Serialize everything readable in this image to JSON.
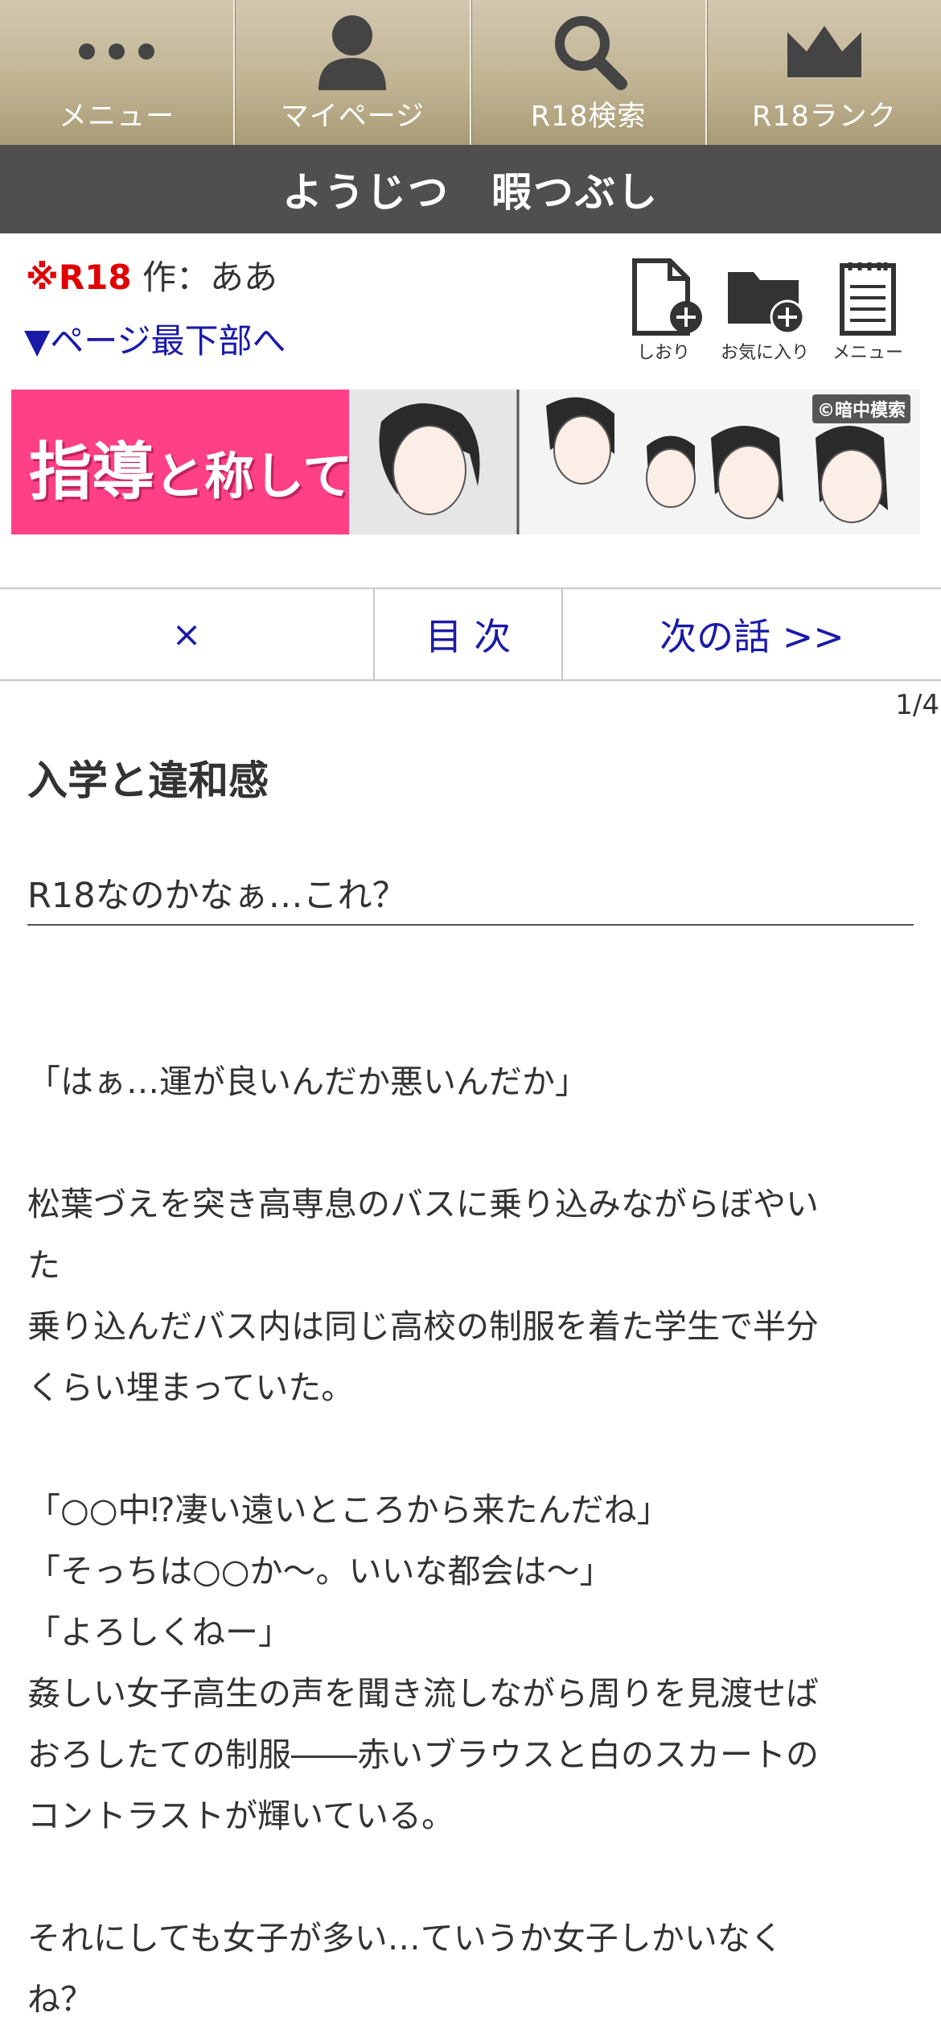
{
  "nav": {
    "items": [
      {
        "label": "メニュー",
        "icon": "dots-icon"
      },
      {
        "label": "マイページ",
        "icon": "person-icon"
      },
      {
        "label": "R18検索",
        "icon": "search-icon"
      },
      {
        "label": "R18ランク",
        "icon": "crown-icon"
      }
    ]
  },
  "title": "ようじつ　暇つぶし",
  "info": {
    "r18_badge": "※R18",
    "author": " 作：ああ",
    "bottom_link": "▼ページ最下部へ"
  },
  "tools": {
    "bookmark_label": "しおり",
    "favorite_label": "お気に入り",
    "menu_label": "メニュー"
  },
  "banner": {
    "headline_big": "指導",
    "headline_small": "と称して…",
    "credit": "©暗中模索"
  },
  "chapter_nav": {
    "close_label": "×",
    "toc_label": "目 次",
    "next_label": "次の話 >>"
  },
  "page_indicator": "1/4",
  "chapter_title": "入学と違和感",
  "subtitle": "R18なのかなぁ…これ？",
  "body_lines": [
    "「はぁ…運が良いんだか悪いんだか」",
    "",
    "松葉づえを突き高専息のバスに乗り込みながらぼやい",
    "た",
    "乗り込んだバス内は同じ高校の制服を着た学生で半分",
    "くらい埋まっていた。",
    "",
    "「○○中⁉凄い遠いところから来たんだね」",
    "「そっちは○○か〜。いいな都会は〜」",
    "「よろしくねー」",
    "姦しい女子高生の声を聞き流しながら周りを見渡せば",
    "おろしたての制服――赤いブラウスと白のスカートの",
    "コントラストが輝いている。",
    "",
    "それにしても女子が多い…ていうか女子しかいなく",
    "ね？"
  ],
  "colors": {
    "nav_gold": "#c1b594",
    "title_bar": "#4f4f4f",
    "r18_red": "#e00000",
    "link_blue": "#1a1aa8",
    "banner_pink": "#ff3f86"
  }
}
